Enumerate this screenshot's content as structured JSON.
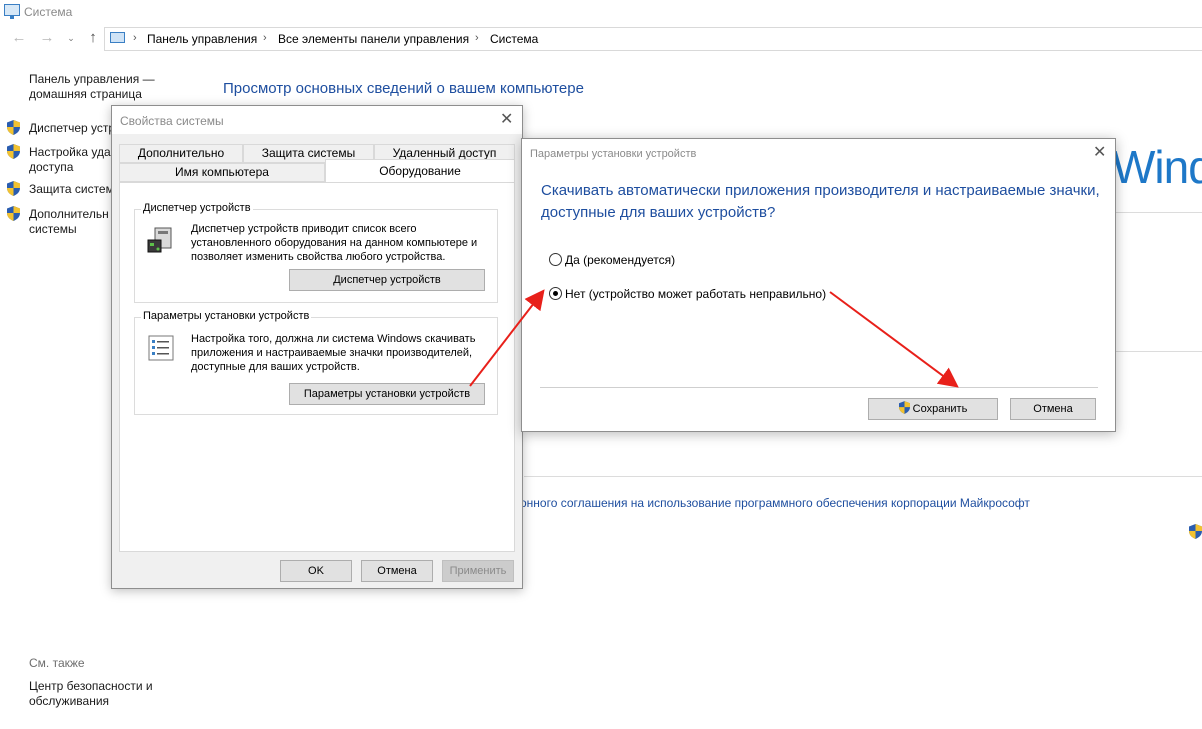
{
  "window": {
    "title": "Система"
  },
  "nav": {
    "back": "←",
    "forward": "→",
    "dropdown": "⌄",
    "up": "↑",
    "breadcrumbs": [
      "Панель управления",
      "Все элементы панели управления",
      "Система"
    ],
    "separator": "›"
  },
  "left_pane": {
    "home_link": "Панель управления — домашняя страница",
    "links": [
      "Диспетчер устр",
      "Настройка уда доступа",
      "Защита систем",
      "Дополнительн системы"
    ],
    "see_also": "См. также",
    "security_center": "Центр безопасности и обслуживания"
  },
  "main": {
    "heading": "Просмотр основных сведений о вашем компьютере",
    "windows_logo_text": "Wind",
    "license_link": "онного соглашения на использование программного обеспечения корпорации Майкрософт"
  },
  "system_properties": {
    "title": "Свойства системы",
    "tabs_row1": [
      "Дополнительно",
      "Защита системы",
      "Удаленный доступ"
    ],
    "tabs_row2": [
      "Имя компьютера",
      "Оборудование"
    ],
    "active_tab": "Оборудование",
    "device_manager": {
      "group_title": "Диспетчер устройств",
      "description": "Диспетчер устройств приводит список всего установленного оборудования на данном компьютере и позволяет изменить свойства любого устройства.",
      "button": "Диспетчер устройств"
    },
    "device_install": {
      "group_title": "Параметры установки устройств",
      "description": "Настройка того, должна ли система Windows скачивать приложения и настраиваемые значки производителей, доступные для ваших устройств.",
      "button": "Параметры установки устройств"
    },
    "buttons": {
      "ok": "OK",
      "cancel": "Отмена",
      "apply": "Применить"
    }
  },
  "device_install_dialog": {
    "title": "Параметры установки устройств",
    "question": "Скачивать автоматически приложения производителя и настраиваемые значки, доступные для ваших устройств?",
    "options": [
      {
        "label": "Да (рекомендуется)",
        "selected": false
      },
      {
        "label": "Нет (устройство может работать неправильно)",
        "selected": true
      }
    ],
    "buttons": {
      "save": "Сохранить",
      "cancel": "Отмена"
    }
  },
  "colors": {
    "accent_blue": "#1e4e9f",
    "arrow_red": "#e8201a",
    "windows_blue": "#1e78c8"
  }
}
